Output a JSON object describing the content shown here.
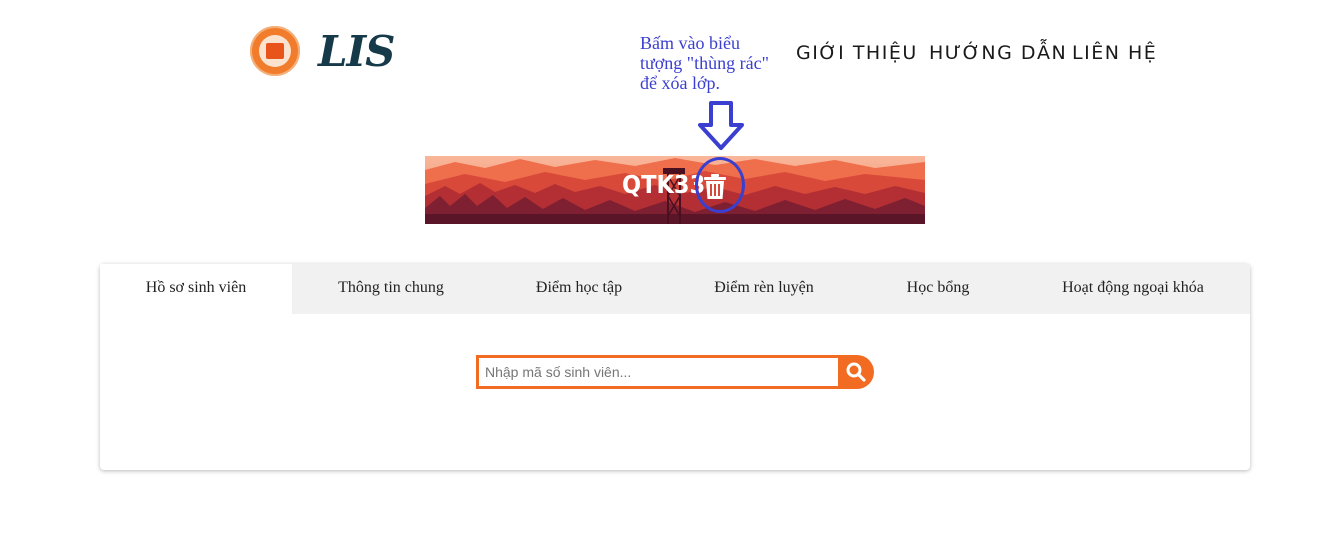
{
  "header": {
    "brand_text": "LIS",
    "logo_icon": "school-logo-icon",
    "nav": [
      {
        "label": "GIỚI THIỆU"
      },
      {
        "label": "HƯỚNG DẪN"
      },
      {
        "label": "LIÊN HỆ"
      }
    ]
  },
  "annotation": {
    "text": "Bấm vào biểu tượng \"thùng rác\" để xóa lớp.",
    "arrow_icon": "arrow-down-icon",
    "color": "#3b3fd0"
  },
  "banner": {
    "class_name": "QTK33",
    "delete_icon": "trash-icon"
  },
  "tabs": [
    {
      "label": "Hồ sơ sinh viên",
      "active": true
    },
    {
      "label": "Thông tin chung",
      "active": false
    },
    {
      "label": "Điểm học tập",
      "active": false
    },
    {
      "label": "Điểm rèn luyện",
      "active": false
    },
    {
      "label": "Học bổng",
      "active": false
    },
    {
      "label": "Hoạt động ngoại khóa",
      "active": false
    }
  ],
  "search": {
    "placeholder": "Nhập mã số sinh viên...",
    "value": "",
    "button_icon": "search-icon"
  },
  "colors": {
    "accent": "#f26b22",
    "annotation": "#3b3fd0"
  }
}
